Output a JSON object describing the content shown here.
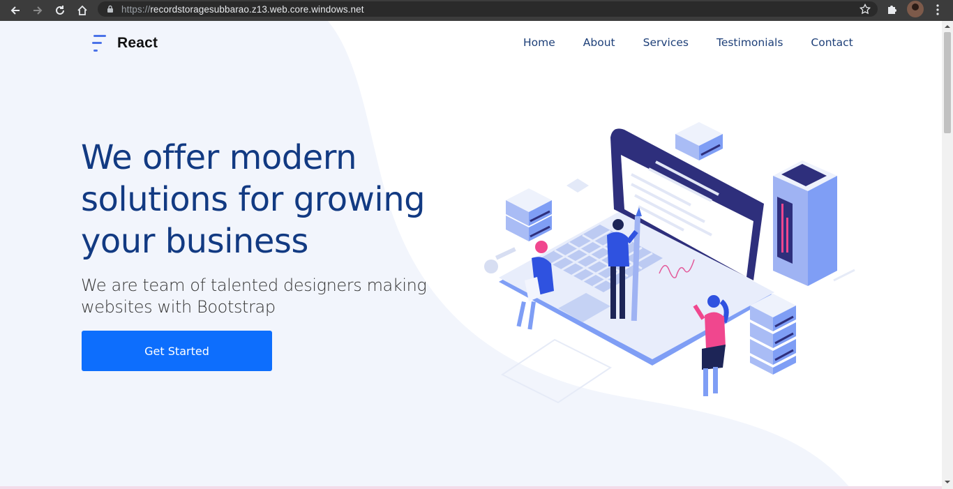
{
  "browser": {
    "url_protocol": "https://",
    "url_host": "recordstoragesubbarao.z13.web.core.windows.net"
  },
  "header": {
    "brand": "React",
    "nav": [
      "Home",
      "About",
      "Services",
      "Testimonials",
      "Contact"
    ]
  },
  "hero": {
    "title": "We offer modern solutions for growing your business",
    "subtitle": "We are team of talented designers making websites with Bootstrap",
    "cta_label": "Get Started"
  },
  "colors": {
    "primary": "#0d6efd",
    "heading": "#123a82",
    "nav_text": "#1d3f78",
    "background_shape": "#f2f5fc",
    "accent_pink": "#f0478e",
    "illustration_blue": "#7f9ef5",
    "illustration_navy": "#2e2f7c"
  }
}
